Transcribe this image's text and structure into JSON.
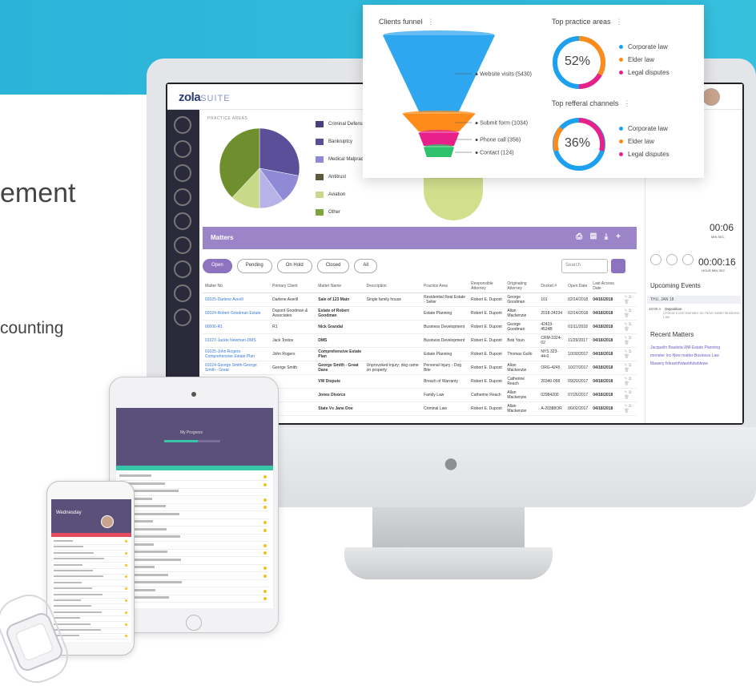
{
  "hero": {
    "line1": "ement",
    "line2": "counting"
  },
  "app": {
    "logo_main": "zola",
    "logo_suite": "SUITE",
    "practice_areas_heading": "PRACTICE AREAS",
    "practice_legend": [
      {
        "label": "Criminal Defense",
        "color": "#4a3f7a"
      },
      {
        "label": "Bankruptcy",
        "color": "#5b4f9a"
      },
      {
        "label": "Medical Malpractice",
        "color": "#8f8ad6"
      },
      {
        "label": "Antitrust",
        "color": "#5b5a3a"
      },
      {
        "label": "Aviation",
        "color": "#c9d98a"
      },
      {
        "label": "Other",
        "color": "#7fa33d"
      }
    ],
    "practice_pie": [
      {
        "value": 28,
        "color": "#5b4f9a"
      },
      {
        "value": 12,
        "color": "#8f8ad6"
      },
      {
        "value": 10,
        "color": "#b7b3e6"
      },
      {
        "value": 12,
        "color": "#c9d98a"
      },
      {
        "value": 38,
        "color": "#6f8f2f"
      }
    ],
    "matters": {
      "title": "Matters",
      "filters": [
        "Open",
        "Pending",
        "On Hold",
        "Closed",
        "All"
      ],
      "active_filter": "Open",
      "search_placeholder": "Search",
      "columns": [
        "Matter No",
        "Primary Client",
        "Matter Name",
        "Description",
        "Practice Area",
        "Responsible Attorney",
        "Originating Attorney",
        "Docket #",
        "Open Date",
        "Last Access Date"
      ],
      "rows": [
        [
          "02025-Darlene Averill",
          "Darlene Averill",
          "Sale of 123 Main",
          "Single family house",
          "Residential Real Estate - Seller",
          "Robert E. Dupont",
          "George Goodman",
          "101",
          "02/14/2018",
          "04/16/2018"
        ],
        [
          "02024-Robert Goodman Estate",
          "Dupont Goodman & Associates",
          "Estate of Robert Goodman",
          "",
          "Estate Planning",
          "Robert E. Dupont",
          "Allan Mackenzie",
          "2018-24234",
          "02/14/2018",
          "04/18/2018"
        ],
        [
          "00006-R1",
          "R1",
          "Nick Grandal",
          "",
          "Business Development",
          "Robert E. Dupont",
          "George Goodman",
          "42423-4524B",
          "01/11/2018",
          "04/18/2018"
        ],
        [
          "01027-Jackie Newman-DMS",
          "Jack Tostos",
          "DMS",
          "",
          "Business Development",
          "Robert E. Dupont",
          "Bob Youn",
          "CRM-2324-02",
          "11/29/2017",
          "04/18/2018"
        ],
        [
          "01025-John Rogers-Comprehensive Estate Plan",
          "John Rogers",
          "Comprehensive Estate Plan",
          "",
          "Estate Planning",
          "Robert E. Dupont",
          "Thomas Gullo",
          "NYS 323-44-0",
          "10/30/2017",
          "04/18/2018"
        ],
        [
          "01024-George Smith-George Smith - Great",
          "George Smith",
          "George Smith - Great Dane",
          "Unprovoked injury; dog came on property",
          "Personal Injury - Dog Bite",
          "Robert E. Dupont",
          "Allan Mackenzie",
          "ORG-4245",
          "10/27/2017",
          "04/18/2018"
        ],
        [
          "",
          "",
          "VW Dispute",
          "",
          "Breach of Warranty",
          "Robert E. Dupont",
          "Catherine Reach",
          "20340-098",
          "09/20/2017",
          "04/18/2018"
        ],
        [
          "",
          "",
          "Jones Divorce",
          "",
          "Family Law",
          "Catherine Reach",
          "Allan Mackenzie",
          "02984200",
          "07/26/2017",
          "04/18/2018"
        ],
        [
          "",
          "",
          "State Vs Jane Doe",
          "",
          "Criminal Law",
          "Robert E. Dupont",
          "Allan Mackenzie",
          "A-20388OR",
          "06/02/2017",
          "04/18/2018"
        ]
      ]
    },
    "right_panel": {
      "timer1": "00:06",
      "timer1_units": "MIN   SEC",
      "timer2": "00:00:16",
      "timer2_units": "HOUR  MIN  SEC",
      "upcoming_title": "Upcoming Events",
      "day_label": "THU, JAN 18",
      "event_time": "10:00 A",
      "event_name": "Deposition",
      "event_detail": "Central Court   Monster Inc-New matter Business Law",
      "recent_title": "Recent Matters",
      "recent_items": [
        "Jacquelin Bautista-Will-Estate Planning",
        "monster Inc-New matter-Business Law",
        "Mawery fsleuehfvdaebfulwblewe"
      ]
    }
  },
  "overlay": {
    "funnel_title": "Clients funnel",
    "funnel_stages": [
      {
        "label": "Website visits (5430)",
        "value": 5430,
        "color": "#2fa7f0"
      },
      {
        "label": "Submit form (1034)",
        "value": 1034,
        "color": "#ff8c1a"
      },
      {
        "label": "Phone call (356)",
        "value": 356,
        "color": "#e8218a"
      },
      {
        "label": "Contact (124)",
        "value": 124,
        "color": "#2dc26b"
      }
    ],
    "top_practice_title": "Top practice areas",
    "top_practice_pct": "52%",
    "top_practice_legend": [
      {
        "label": "Corporate law",
        "color": "#1ea0f0"
      },
      {
        "label": "Elder law",
        "color": "#ff8c1a"
      },
      {
        "label": "Legal disputes",
        "color": "#e8218a"
      }
    ],
    "referral_title": "Top refferal channels",
    "referral_pct": "36%",
    "referral_legend": [
      {
        "label": "Corporate law",
        "color": "#1ea0f0"
      },
      {
        "label": "Elder law",
        "color": "#ff8c1a"
      },
      {
        "label": "Legal disputes",
        "color": "#e8218a"
      }
    ],
    "dots_icon": "more-vertical-icon"
  },
  "ipad": {
    "title": "My Progress"
  },
  "iphone": {
    "day": "Wednesday"
  }
}
